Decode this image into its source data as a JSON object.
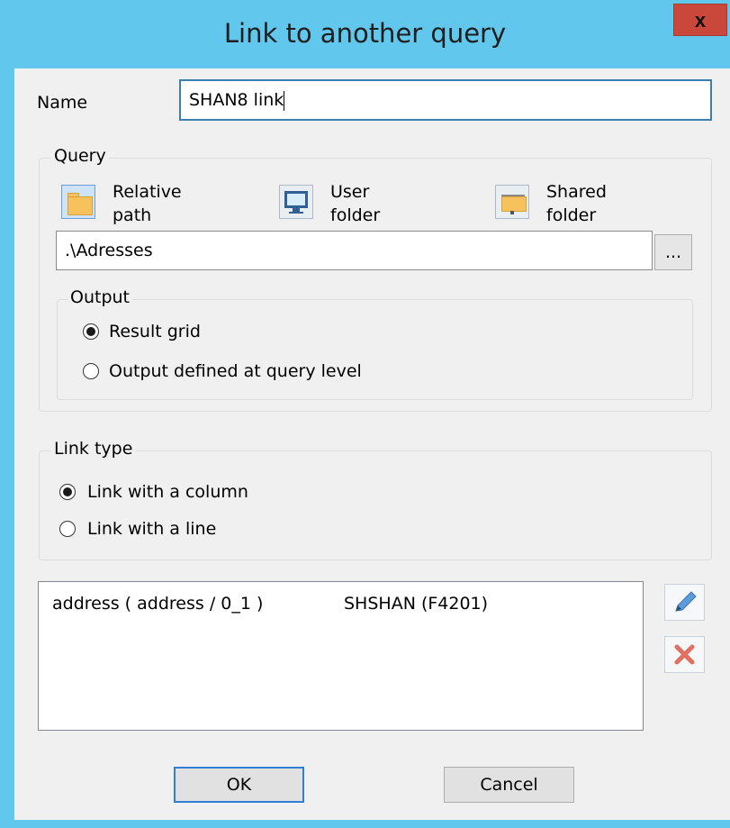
{
  "window": {
    "title": "Link to another query",
    "close_glyph": "x"
  },
  "name_field": {
    "label": "Name",
    "value": "SHAN8 link"
  },
  "query_group": {
    "title": "Query",
    "location_options": [
      {
        "label_line1": "Relative",
        "label_line2": "path",
        "icon": "folder-icon",
        "selected": true
      },
      {
        "label_line1": "User",
        "label_line2": "folder",
        "icon": "monitor-icon",
        "selected": false
      },
      {
        "label_line1": "Shared",
        "label_line2": "folder",
        "icon": "shared-folder-icon",
        "selected": false
      }
    ],
    "path_value": ".\\Adresses",
    "browse_label": "...",
    "output": {
      "title": "Output",
      "options": [
        {
          "label": "Result grid",
          "checked": true
        },
        {
          "label": "Output defined at query level",
          "checked": false
        }
      ]
    }
  },
  "link_type": {
    "title": "Link type",
    "options": [
      {
        "label": "Link with a column",
        "checked": true
      },
      {
        "label": "Link with a line",
        "checked": false
      }
    ]
  },
  "links_list": {
    "rows": [
      {
        "source": "address ( address / 0_1 )",
        "target": "SHSHAN (F4201)"
      }
    ]
  },
  "side_actions": {
    "edit_icon": "pencil-icon",
    "delete_icon": "delete-x-icon"
  },
  "buttons": {
    "ok": "OK",
    "cancel": "Cancel"
  },
  "colors": {
    "titlebar": "#62c7ec",
    "close": "#c9483b",
    "body": "#f0f0f0",
    "accent": "#2f7fd4"
  }
}
